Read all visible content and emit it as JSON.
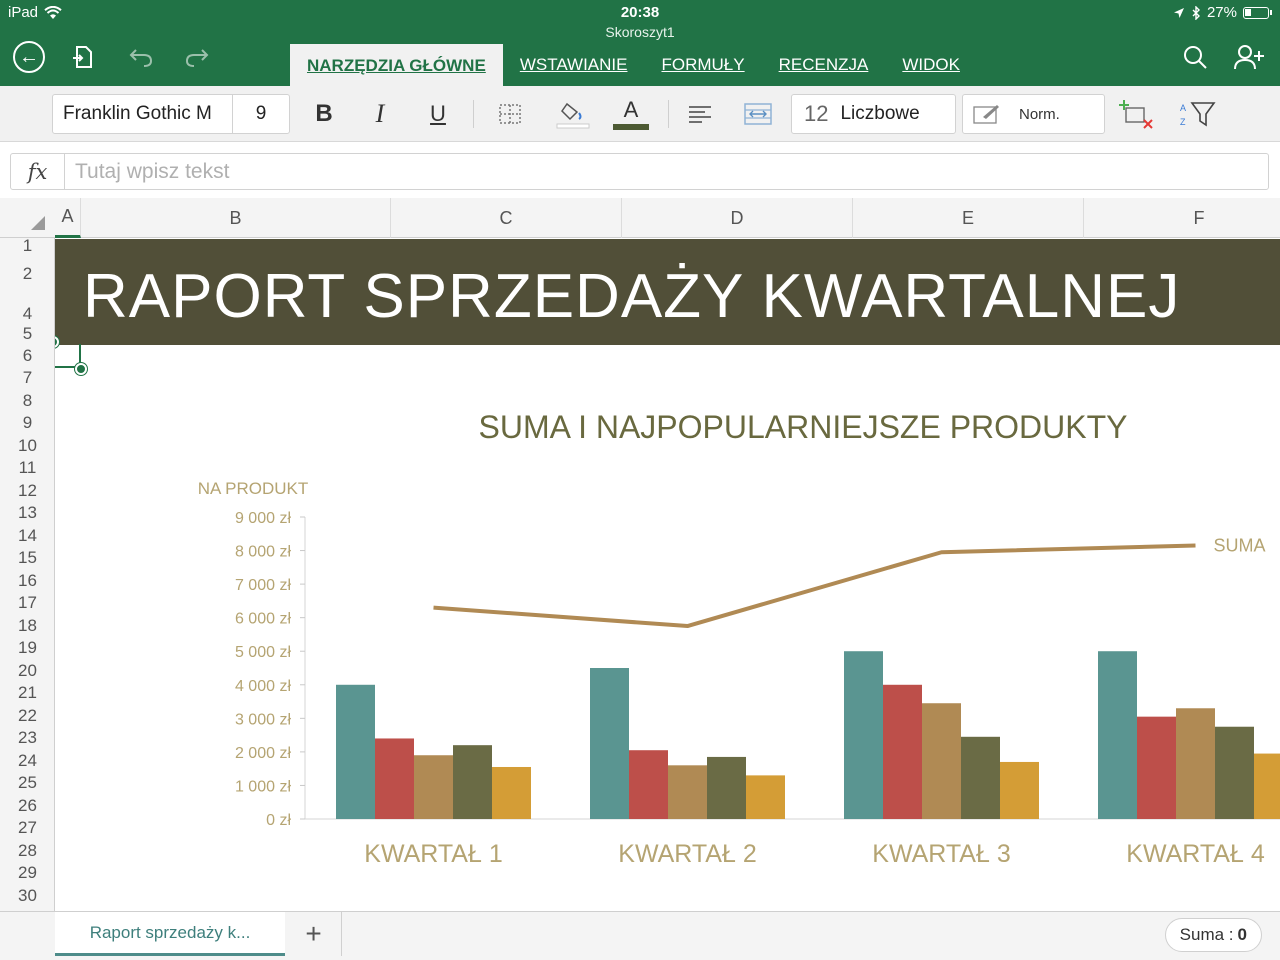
{
  "status": {
    "device": "iPad",
    "time": "20:38",
    "battery": "27%"
  },
  "document": {
    "title": "Skoroszyt1"
  },
  "tabs": [
    {
      "label": "NARZĘDZIA GŁÓWNE",
      "active": true
    },
    {
      "label": "WSTAWIANIE",
      "active": false
    },
    {
      "label": "FORMUŁY",
      "active": false
    },
    {
      "label": "RECENZJA",
      "active": false
    },
    {
      "label": "WIDOK",
      "active": false
    }
  ],
  "ribbon": {
    "font_name": "Franklin Gothic M",
    "font_size": "9",
    "bold": "B",
    "italic": "I",
    "underline": "U",
    "font_color_letter": "A",
    "font_color": "#4d5a33",
    "number_format_icon": "12",
    "number_format": "Liczbowe",
    "cell_style": "Norm."
  },
  "formula_bar": {
    "fx": "fx",
    "placeholder": "Tutaj wpisz tekst",
    "value": ""
  },
  "columns": [
    "A",
    "B",
    "C",
    "D",
    "E",
    "F"
  ],
  "rows": [
    "1",
    "2",
    "4",
    "5",
    "6",
    "7",
    "8",
    "9",
    "10",
    "11",
    "12",
    "13",
    "14",
    "15",
    "16",
    "17",
    "18",
    "19",
    "20",
    "21",
    "22",
    "23",
    "24",
    "25",
    "26",
    "27",
    "28",
    "29",
    "30"
  ],
  "banner": {
    "title": "RAPORT SPRZEDAŻY KWARTALNEJ",
    "bg_color": "#514f38"
  },
  "chart_data": {
    "type": "bar",
    "title": "SUMA I NAJPOPULARNIEJSZE PRODUKTY",
    "ylabel": "NA PRODUKT",
    "categories": [
      "KWARTAŁ 1",
      "KWARTAŁ 2",
      "KWARTAŁ 3",
      "KWARTAŁ 4"
    ],
    "ylim": [
      0,
      9000
    ],
    "yticks": [
      "0 zł",
      "1 000 zł",
      "2 000 zł",
      "3 000 zł",
      "4 000 zł",
      "5 000 zł",
      "6 000 zł",
      "7 000 zł",
      "8 000 zł",
      "9 000 zł"
    ],
    "series": [
      {
        "color": "#5a9591",
        "values": [
          4000,
          4500,
          5000,
          5000
        ]
      },
      {
        "color": "#bd4f4a",
        "values": [
          2400,
          2050,
          4000,
          3050
        ]
      },
      {
        "color": "#b08a54",
        "values": [
          1900,
          1600,
          3450,
          3300
        ]
      },
      {
        "color": "#6a6b45",
        "values": [
          2200,
          1850,
          2450,
          2750
        ]
      },
      {
        "color": "#d49d36",
        "values": [
          1550,
          1300,
          1700,
          1950
        ]
      }
    ],
    "line_series": {
      "name": "SUMA",
      "color": "#b08a54",
      "values": [
        6300,
        5750,
        7950,
        8150
      ]
    },
    "grid": false,
    "legend": "none"
  },
  "sheet_tab": {
    "label": "Raport sprzedaży k..."
  },
  "add_sheet": "+",
  "status_sum": {
    "label": "Suma :",
    "value": "0"
  }
}
